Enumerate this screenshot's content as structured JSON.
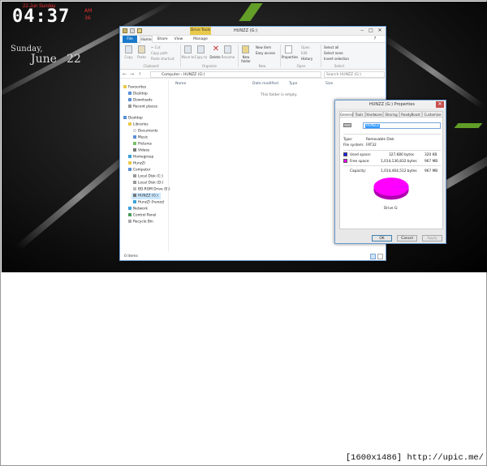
{
  "desktop": {
    "clock_top": "22-Jun  Sunday",
    "time": "04:37",
    "ampm": "AM",
    "seconds": "36",
    "weekday": "Sunday,",
    "month": "June",
    "day": "22"
  },
  "explorer": {
    "title": "HUNZZ (G:)",
    "contextual_tab": "Drive Tools",
    "tabs": [
      "File",
      "Home",
      "Share",
      "View",
      "Manage"
    ],
    "ribbon": {
      "copy": "Copy",
      "paste": "Paste",
      "cut": "Cut",
      "copy_path": "Copy path",
      "paste_shortcut": "Paste shortcut",
      "move_to": "Move to",
      "copy_to": "Copy to",
      "delete": "Delete",
      "rename": "Rename",
      "new_folder": "New folder",
      "new_item": "New item",
      "easy_access": "Easy access",
      "properties": "Properties",
      "open": "Open",
      "edit": "Edit",
      "history": "History",
      "select_all": "Select all",
      "select_none": "Select none",
      "invert_selection": "Invert selection",
      "groups": [
        "Clipboard",
        "Organize",
        "New",
        "Open",
        "Select"
      ]
    },
    "address": [
      "Computer",
      "HUNZZ (G:)"
    ],
    "search_placeholder": "Search HUNZZ (G:)",
    "columns": [
      "Name",
      "Date modified",
      "Type",
      "Size"
    ],
    "empty_message": "This folder is empty.",
    "nav": [
      "Favourites",
      "Desktop",
      "Downloads",
      "Recent places",
      "Desktop",
      "Libraries",
      "Documents",
      "Music",
      "Pictures",
      "Videos",
      "Homegroup",
      "HunzZi",
      "Computer",
      "Local Disk (C:)",
      "Local Disk (D:)",
      "BD-ROM Drive (E:)",
      "HUNZZ (G:)",
      "HunzZi (hunzz)",
      "Network",
      "Control Panel",
      "Recycle Bin"
    ],
    "status": "0 items"
  },
  "properties": {
    "title": "HUNZZ (G:) Properties",
    "tabs": [
      "General",
      "Tools",
      "Hardware",
      "Sharing",
      "ReadyBoost",
      "Customise"
    ],
    "name_value": "HUNZZ",
    "type_label": "Type:",
    "type_value": "Removable Disk",
    "fs_label": "File system:",
    "fs_value": "FAT32",
    "used_label": "Used space:",
    "used_bytes": "327,680 bytes",
    "used_human": "320 KB",
    "free_label": "Free space:",
    "free_bytes": "1,014,136,832 bytes",
    "free_human": "967 MB",
    "capacity_label": "Capacity:",
    "capacity_bytes": "1,014,464,512 bytes",
    "capacity_human": "967 MB",
    "drive_label": "Drive G:",
    "ok": "OK",
    "cancel": "Cancel",
    "apply": "Apply",
    "colors": {
      "used": "#1a1aff",
      "free": "#ff00ff"
    }
  },
  "watermark": "[1600x1486] http://upic.me/"
}
